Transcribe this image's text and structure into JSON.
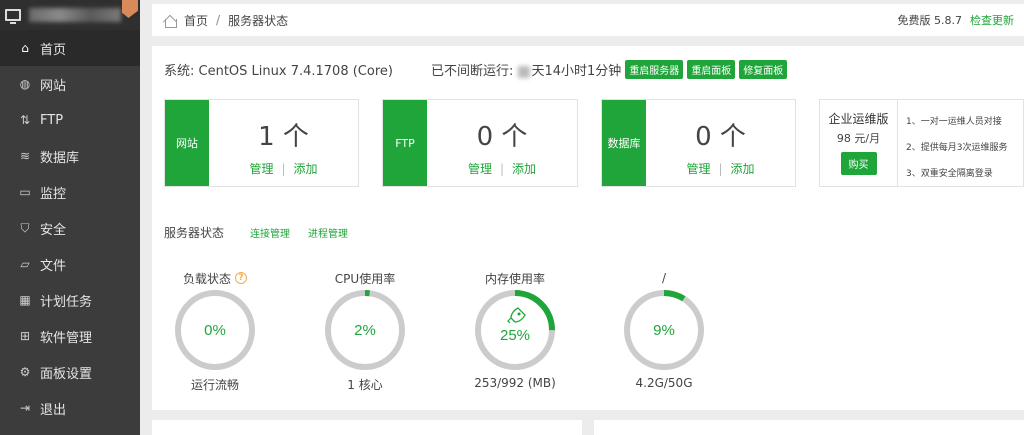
{
  "colors": {
    "accent": "#20a53a",
    "sidebar_bg": "#3c3c3c",
    "ring_bg": "#cccccc",
    "warn": "#f0ad4e"
  },
  "sidebar": {
    "items": [
      {
        "label": "首页",
        "icon": "home-icon",
        "active": true
      },
      {
        "label": "网站",
        "icon": "globe-icon"
      },
      {
        "label": "FTP",
        "icon": "ftp-icon"
      },
      {
        "label": "数据库",
        "icon": "database-icon"
      },
      {
        "label": "监控",
        "icon": "monitor-icon"
      },
      {
        "label": "安全",
        "icon": "shield-icon"
      },
      {
        "label": "文件",
        "icon": "folder-icon"
      },
      {
        "label": "计划任务",
        "icon": "calendar-icon"
      },
      {
        "label": "软件管理",
        "icon": "grid-icon"
      },
      {
        "label": "面板设置",
        "icon": "gear-icon"
      },
      {
        "label": "退出",
        "icon": "logout-icon"
      }
    ]
  },
  "header": {
    "breadcrumb_home": "首页",
    "breadcrumb_sep": "/",
    "breadcrumb_current": "服务器状态",
    "version": "免费版 5.8.7",
    "update_link": "检查更新"
  },
  "system": {
    "os": "系统: CentOS Linux 7.4.1708 (Core)",
    "uptime_prefix": "已不间断运行: ",
    "uptime_suffix": "天14小时1分钟",
    "buttons": [
      "重启服务器",
      "重启面板",
      "修复面板"
    ]
  },
  "cards": [
    {
      "name": "网站",
      "count": "1 个",
      "manage": "管理",
      "add": "添加"
    },
    {
      "name": "FTP",
      "count": "0 个",
      "manage": "管理",
      "add": "添加"
    },
    {
      "name": "数据库",
      "count": "0 个",
      "manage": "管理",
      "add": "添加"
    }
  ],
  "enterprise": {
    "title": "企业运维版",
    "price": "98 元/月",
    "buy": "购买",
    "features": [
      "1、一对一运维人员对接",
      "2、提供每月3次运维服务",
      "3、双重安全隔离登录"
    ]
  },
  "server_status": {
    "title": "服务器状态",
    "links": [
      "连接管理",
      "进程管理"
    ],
    "gauges": [
      {
        "label": "负载状态",
        "value_text": "0%",
        "percent": 0,
        "bottom": "运行流畅",
        "help": "?"
      },
      {
        "label": "CPU使用率",
        "value_text": "2%",
        "percent": 2,
        "bottom": "1 核心"
      },
      {
        "label": "内存使用率",
        "value_text": "25%",
        "percent": 25,
        "bottom": "253/992 (MB)",
        "icon": "rocket-icon"
      },
      {
        "label": "/",
        "value_text": "9%",
        "percent": 9,
        "bottom": "4.2G/50G"
      }
    ]
  }
}
